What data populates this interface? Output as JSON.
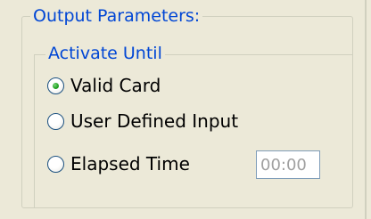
{
  "output_parameters": {
    "title": "Output Parameters:",
    "activate_until": {
      "title": "Activate Until",
      "options": [
        {
          "label": "Valid Card",
          "selected": true
        },
        {
          "label": "User Defined Input",
          "selected": false
        },
        {
          "label": "Elapsed Time",
          "selected": false
        }
      ],
      "elapsed_time_value": "00:00"
    }
  }
}
